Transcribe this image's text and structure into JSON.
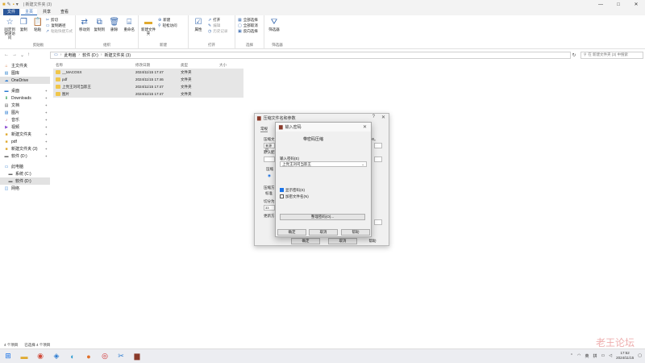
{
  "window": {
    "title": "| 新建文件夹 (3)",
    "controls": [
      "—",
      "□",
      "✕"
    ]
  },
  "ribbon_tabs": [
    "文件",
    "主页",
    "共享",
    "查看"
  ],
  "ribbon": {
    "clipboard": {
      "pin_label": "固定到快速访问",
      "copy": "复制",
      "paste": "粘贴",
      "cut": "剪切",
      "copy_path": "复制路径",
      "paste_shortcut": "粘贴快捷方式",
      "group": "剪贴板"
    },
    "organize": {
      "move_to": "移动到",
      "copy_to": "复制到",
      "delete": "删除",
      "rename": "重命名",
      "group": "组织"
    },
    "new": {
      "new_folder": "新建文件夹",
      "new_item": "新建",
      "easy_access": "轻松访问",
      "group": "新建"
    },
    "open": {
      "properties": "属性",
      "open": "打开",
      "edit": "编辑",
      "history": "历史记录",
      "group": "打开"
    },
    "select": {
      "select_all": "全部选择",
      "select_none": "全部取消",
      "invert": "反向选择",
      "group": "选择"
    },
    "filter": {
      "label": "筛选器",
      "group": "筛选器"
    }
  },
  "address": {
    "path": [
      "此电脑",
      "软件 (D:)",
      "新建文件夹 (3)"
    ],
    "search_placeholder": "在 新建文件夹 (3) 中搜索"
  },
  "sidebar": {
    "items": [
      {
        "label": "主文件夹",
        "icon": "home-icon"
      },
      {
        "label": "图库",
        "icon": "gallery-icon"
      },
      {
        "label": "OneDrive",
        "icon": "cloud-icon",
        "selected": true
      },
      {
        "label": "桌面",
        "icon": "desktop-icon",
        "pinned": true
      },
      {
        "label": "Downloads",
        "icon": "download-icon",
        "pinned": true
      },
      {
        "label": "文档",
        "icon": "document-icon",
        "pinned": true
      },
      {
        "label": "图片",
        "icon": "picture-icon",
        "pinned": true
      },
      {
        "label": "音乐",
        "icon": "music-icon",
        "pinned": true
      },
      {
        "label": "视频",
        "icon": "video-icon",
        "pinned": true
      },
      {
        "label": "新建文件夹",
        "icon": "folder-icon",
        "pinned": true
      },
      {
        "label": "pdf",
        "icon": "folder-icon",
        "pinned": true
      },
      {
        "label": "新建文件夹 (3)",
        "icon": "folder-icon",
        "pinned": true
      },
      {
        "label": "软件 (D:)",
        "icon": "drive-icon",
        "pinned": true
      },
      {
        "label": "此电脑",
        "icon": "computer-icon"
      },
      {
        "label": "系统 (C:)",
        "icon": "drive-icon"
      },
      {
        "label": "软件 (D:)",
        "icon": "drive-icon",
        "selected": true
      },
      {
        "label": "网络",
        "icon": "network-icon"
      }
    ]
  },
  "files": {
    "headers": [
      "名称",
      "修改日期",
      "类型",
      "大小"
    ],
    "rows": [
      {
        "name": "__MACOSX",
        "date": "2024/11/15 17:47",
        "type": "文件夹"
      },
      {
        "name": "pdf",
        "date": "2024/11/15 17:46",
        "type": "文件夹"
      },
      {
        "name": "上党王刘司当影王",
        "date": "2024/11/15 17:47",
        "type": "文件夹"
      },
      {
        "name": "图片",
        "date": "2024/11/15 17:47",
        "type": "文件夹"
      }
    ]
  },
  "zip_dialog": {
    "title": "压缩文件名和参数",
    "tab": "常规",
    "help": "?",
    "close": "✕",
    "label_archive": "压缩文",
    "value_fragment": "来源目",
    "label_default": "默认配",
    "label_format": "压缩",
    "label_method": "压缩方",
    "value_method": "标准",
    "label_split": "切分为",
    "split_value": "33",
    "label_update": "更新方",
    "ok": "确定",
    "cancel": "取消",
    "help_btn": "帮助",
    "fragment_right": "00。"
  },
  "pwd_dialog": {
    "title": "输入密码",
    "heading": "带密码压缩",
    "input_label": "输入密码(E)",
    "input_value": "上党王刘司当影王",
    "show_password": "显示密码(S)",
    "encrypt_names": "加密文件名(N)",
    "organize_btn": "整理密码(O)...",
    "ok": "确定",
    "cancel": "取消",
    "help": "帮助",
    "close": "✕"
  },
  "statusbar": {
    "items": "4 个项目",
    "selected": "已选择 4 个项目"
  },
  "taskbar": {
    "time": "17:52",
    "date": "2024/11/15",
    "lang": "英",
    "input": "拼",
    "watermark": "老王论坛"
  }
}
